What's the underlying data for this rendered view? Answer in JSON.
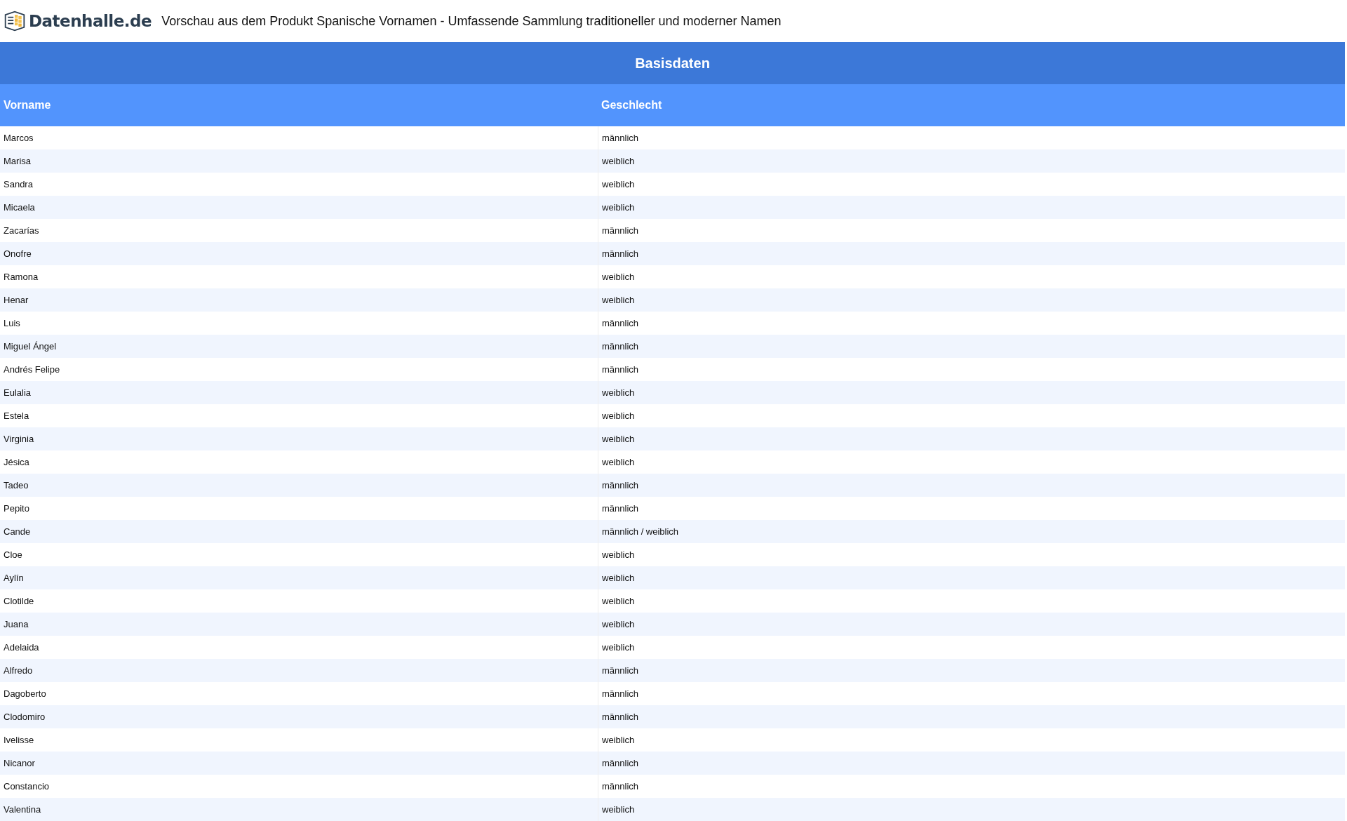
{
  "header": {
    "logo_text": "Datenhalle.de",
    "title": "Vorschau aus dem Produkt Spanische Vornamen - Umfassende Sammlung traditioneller und moderner Namen"
  },
  "table": {
    "caption": "Basisdaten",
    "columns": [
      "Vorname",
      "Geschlecht"
    ],
    "rows": [
      [
        "Marcos",
        "männlich"
      ],
      [
        "Marisa",
        "weiblich"
      ],
      [
        "Sandra",
        "weiblich"
      ],
      [
        "Micaela",
        "weiblich"
      ],
      [
        "Zacarías",
        "männlich"
      ],
      [
        "Onofre",
        "männlich"
      ],
      [
        "Ramona",
        "weiblich"
      ],
      [
        "Henar",
        "weiblich"
      ],
      [
        "Luis",
        "männlich"
      ],
      [
        "Miguel Ángel",
        "männlich"
      ],
      [
        "Andrés Felipe",
        "männlich"
      ],
      [
        "Eulalia",
        "weiblich"
      ],
      [
        "Estela",
        "weiblich"
      ],
      [
        "Virginia",
        "weiblich"
      ],
      [
        "Jésica",
        "weiblich"
      ],
      [
        "Tadeo",
        "männlich"
      ],
      [
        "Pepito",
        "männlich"
      ],
      [
        "Cande",
        "männlich / weiblich"
      ],
      [
        "Cloe",
        "weiblich"
      ],
      [
        "Aylín",
        "weiblich"
      ],
      [
        "Clotilde",
        "weiblich"
      ],
      [
        "Juana",
        "weiblich"
      ],
      [
        "Adelaida",
        "weiblich"
      ],
      [
        "Alfredo",
        "männlich"
      ],
      [
        "Dagoberto",
        "männlich"
      ],
      [
        "Clodomiro",
        "männlich"
      ],
      [
        "Ivelisse",
        "weiblich"
      ],
      [
        "Nicanor",
        "männlich"
      ],
      [
        "Constancio",
        "männlich"
      ],
      [
        "Valentina",
        "weiblich"
      ]
    ]
  }
}
